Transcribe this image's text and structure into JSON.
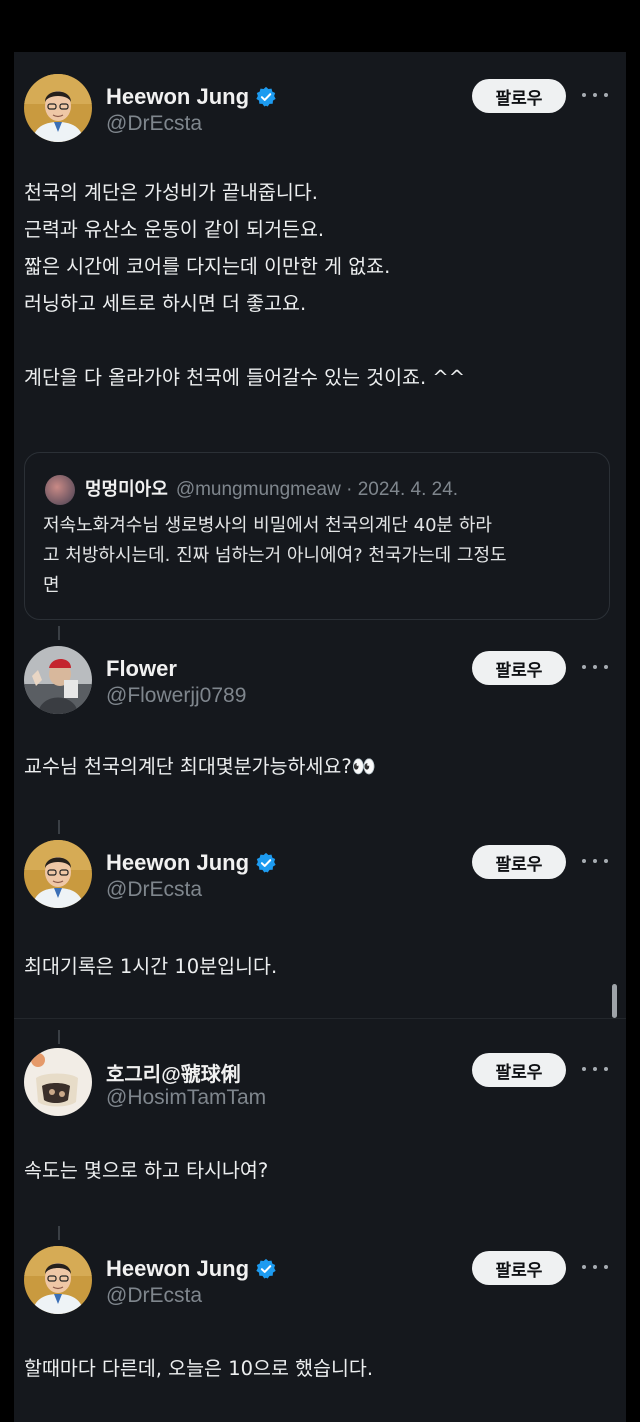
{
  "posts": [
    {
      "name": "Heewon Jung",
      "handle": "@DrEcsta",
      "verified": true,
      "follow_label": "팔로우",
      "body": "천국의 계단은 가성비가 끝내줍니다.\n근력과 유산소 운동이 같이 되거든요.\n짧은 시간에 코어를 다지는데 이만한 게 없죠.\n러닝하고 세트로 하시면 더 좋고요.\n\n계단을 다 올라가야 천국에 들어갈수 있는 것이죠. ^^",
      "quote": {
        "name": "멍멍미아오",
        "handle_date": "@mungmungmeaw · 2024. 4. 24.",
        "text": "저속노화겨수님 생로병사의 비밀에서 천국의계단 40분 하라\n고 처방하시는데. 진짜 넘하는거 아니에여? 천국가는데 그정도\n면"
      }
    },
    {
      "name": "Flower",
      "handle": "@Flowerjj0789",
      "verified": false,
      "follow_label": "팔로우",
      "body": "교수님 천국의계단 최대몇분가능하세요?👀"
    },
    {
      "name": "Heewon Jung",
      "handle": "@DrEcsta",
      "verified": true,
      "follow_label": "팔로우",
      "body": "최대기록은 1시간 10분입니다."
    },
    {
      "name": "호그리@虢球俐",
      "handle": "@HosimTamTam",
      "verified": false,
      "follow_label": "팔로우",
      "body": "속도는 몇으로 하고 타시나여?"
    },
    {
      "name": "Heewon Jung",
      "handle": "@DrEcsta",
      "verified": true,
      "follow_label": "팔로우",
      "body": "할때마다 다른데, 오늘은 10으로 했습니다."
    }
  ],
  "colors": {
    "background": "#15181d",
    "verified_badge": "#1d9bf0",
    "follow_button": "#eff1f2",
    "handle_text": "#7f868d"
  },
  "icons": [
    "verified-badge-icon",
    "more-options-icon",
    "avatar"
  ]
}
